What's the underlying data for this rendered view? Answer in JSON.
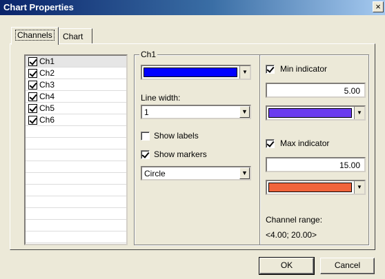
{
  "window": {
    "title": "Chart Properties",
    "close_glyph": "×"
  },
  "tabs": [
    {
      "label": "Channels"
    },
    {
      "label": "Chart"
    }
  ],
  "channels": [
    {
      "label": "Ch1",
      "checked": true
    },
    {
      "label": "Ch2",
      "checked": true
    },
    {
      "label": "Ch3",
      "checked": true
    },
    {
      "label": "Ch4",
      "checked": true
    },
    {
      "label": "Ch5",
      "checked": true
    },
    {
      "label": "Ch6",
      "checked": true
    }
  ],
  "group": {
    "title": "Ch1",
    "color": "#0000ff",
    "line_width_label": "Line width:",
    "line_width_value": "1",
    "show_labels_label": "Show labels",
    "show_labels_checked": false,
    "show_markers_label": "Show markers",
    "show_markers_checked": true,
    "marker_style": "Circle",
    "min_indicator_label": "Min indicator",
    "min_indicator_checked": true,
    "min_value": "5.00",
    "min_color": "#6a3cf0",
    "max_indicator_label": "Max indicator",
    "max_indicator_checked": true,
    "max_value": "15.00",
    "max_color": "#f0643c",
    "range_label": "Channel range:",
    "range_value": "<4.00; 20.00>"
  },
  "buttons": {
    "ok": "OK",
    "cancel": "Cancel"
  },
  "icons": {
    "dropdown_arrow": "▼"
  }
}
